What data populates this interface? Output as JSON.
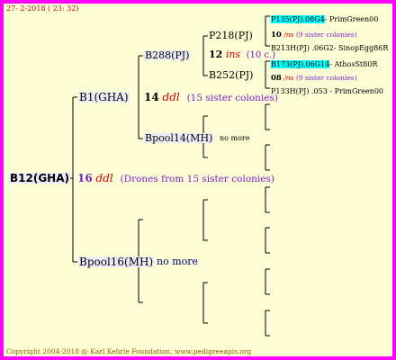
{
  "header": {
    "date": "27- 2-2018 ( 23: 32)"
  },
  "footer": {
    "copyright": "Copyright 2004-2018 @ Karl Kehrle Foundation.   www.pedigreeapis.org"
  },
  "root": {
    "name": "B12(GHA)",
    "number": "16",
    "type": "ddl",
    "note": "(Drones from 15 sister colonies)"
  },
  "gen1": {
    "father": {
      "name": "B1(GHA)",
      "number": "14",
      "type": "ddl",
      "note": "(15 sister colonies)"
    },
    "mother": {
      "name": "Bpool16(MH)",
      "note": "no more"
    }
  },
  "gen2": {
    "ff": {
      "name": "B288(PJ)"
    },
    "fm": {
      "name": "Bpool14(MH)",
      "note": "no more"
    }
  },
  "gen3": {
    "fff": {
      "name": "P218(PJ)",
      "number": "12",
      "type": "ins",
      "note": "(10 c.)"
    },
    "ffm": {
      "name": "B252(PJ)"
    }
  },
  "gen4": {
    "a": {
      "id": "P135(PJ)",
      "code": ".08G4",
      "breeder": "- PrimGreen00",
      "number": "10",
      "type": "/ns",
      "note": "(9 sister colonies)"
    },
    "b": {
      "id": "B213H(PJ)",
      "code": ".06G2",
      "breeder": "- SinopEgg86R"
    },
    "c": {
      "id": "B173(PJ)",
      "code": ".06G14",
      "breeder": "- AthosSt80R",
      "number": "08",
      "type": "/ns",
      "note": "(9 sister colonies)"
    },
    "d": {
      "id": "P133H(PJ)",
      "code": ".05",
      "breeder": "3 - PrimGreen00"
    }
  }
}
